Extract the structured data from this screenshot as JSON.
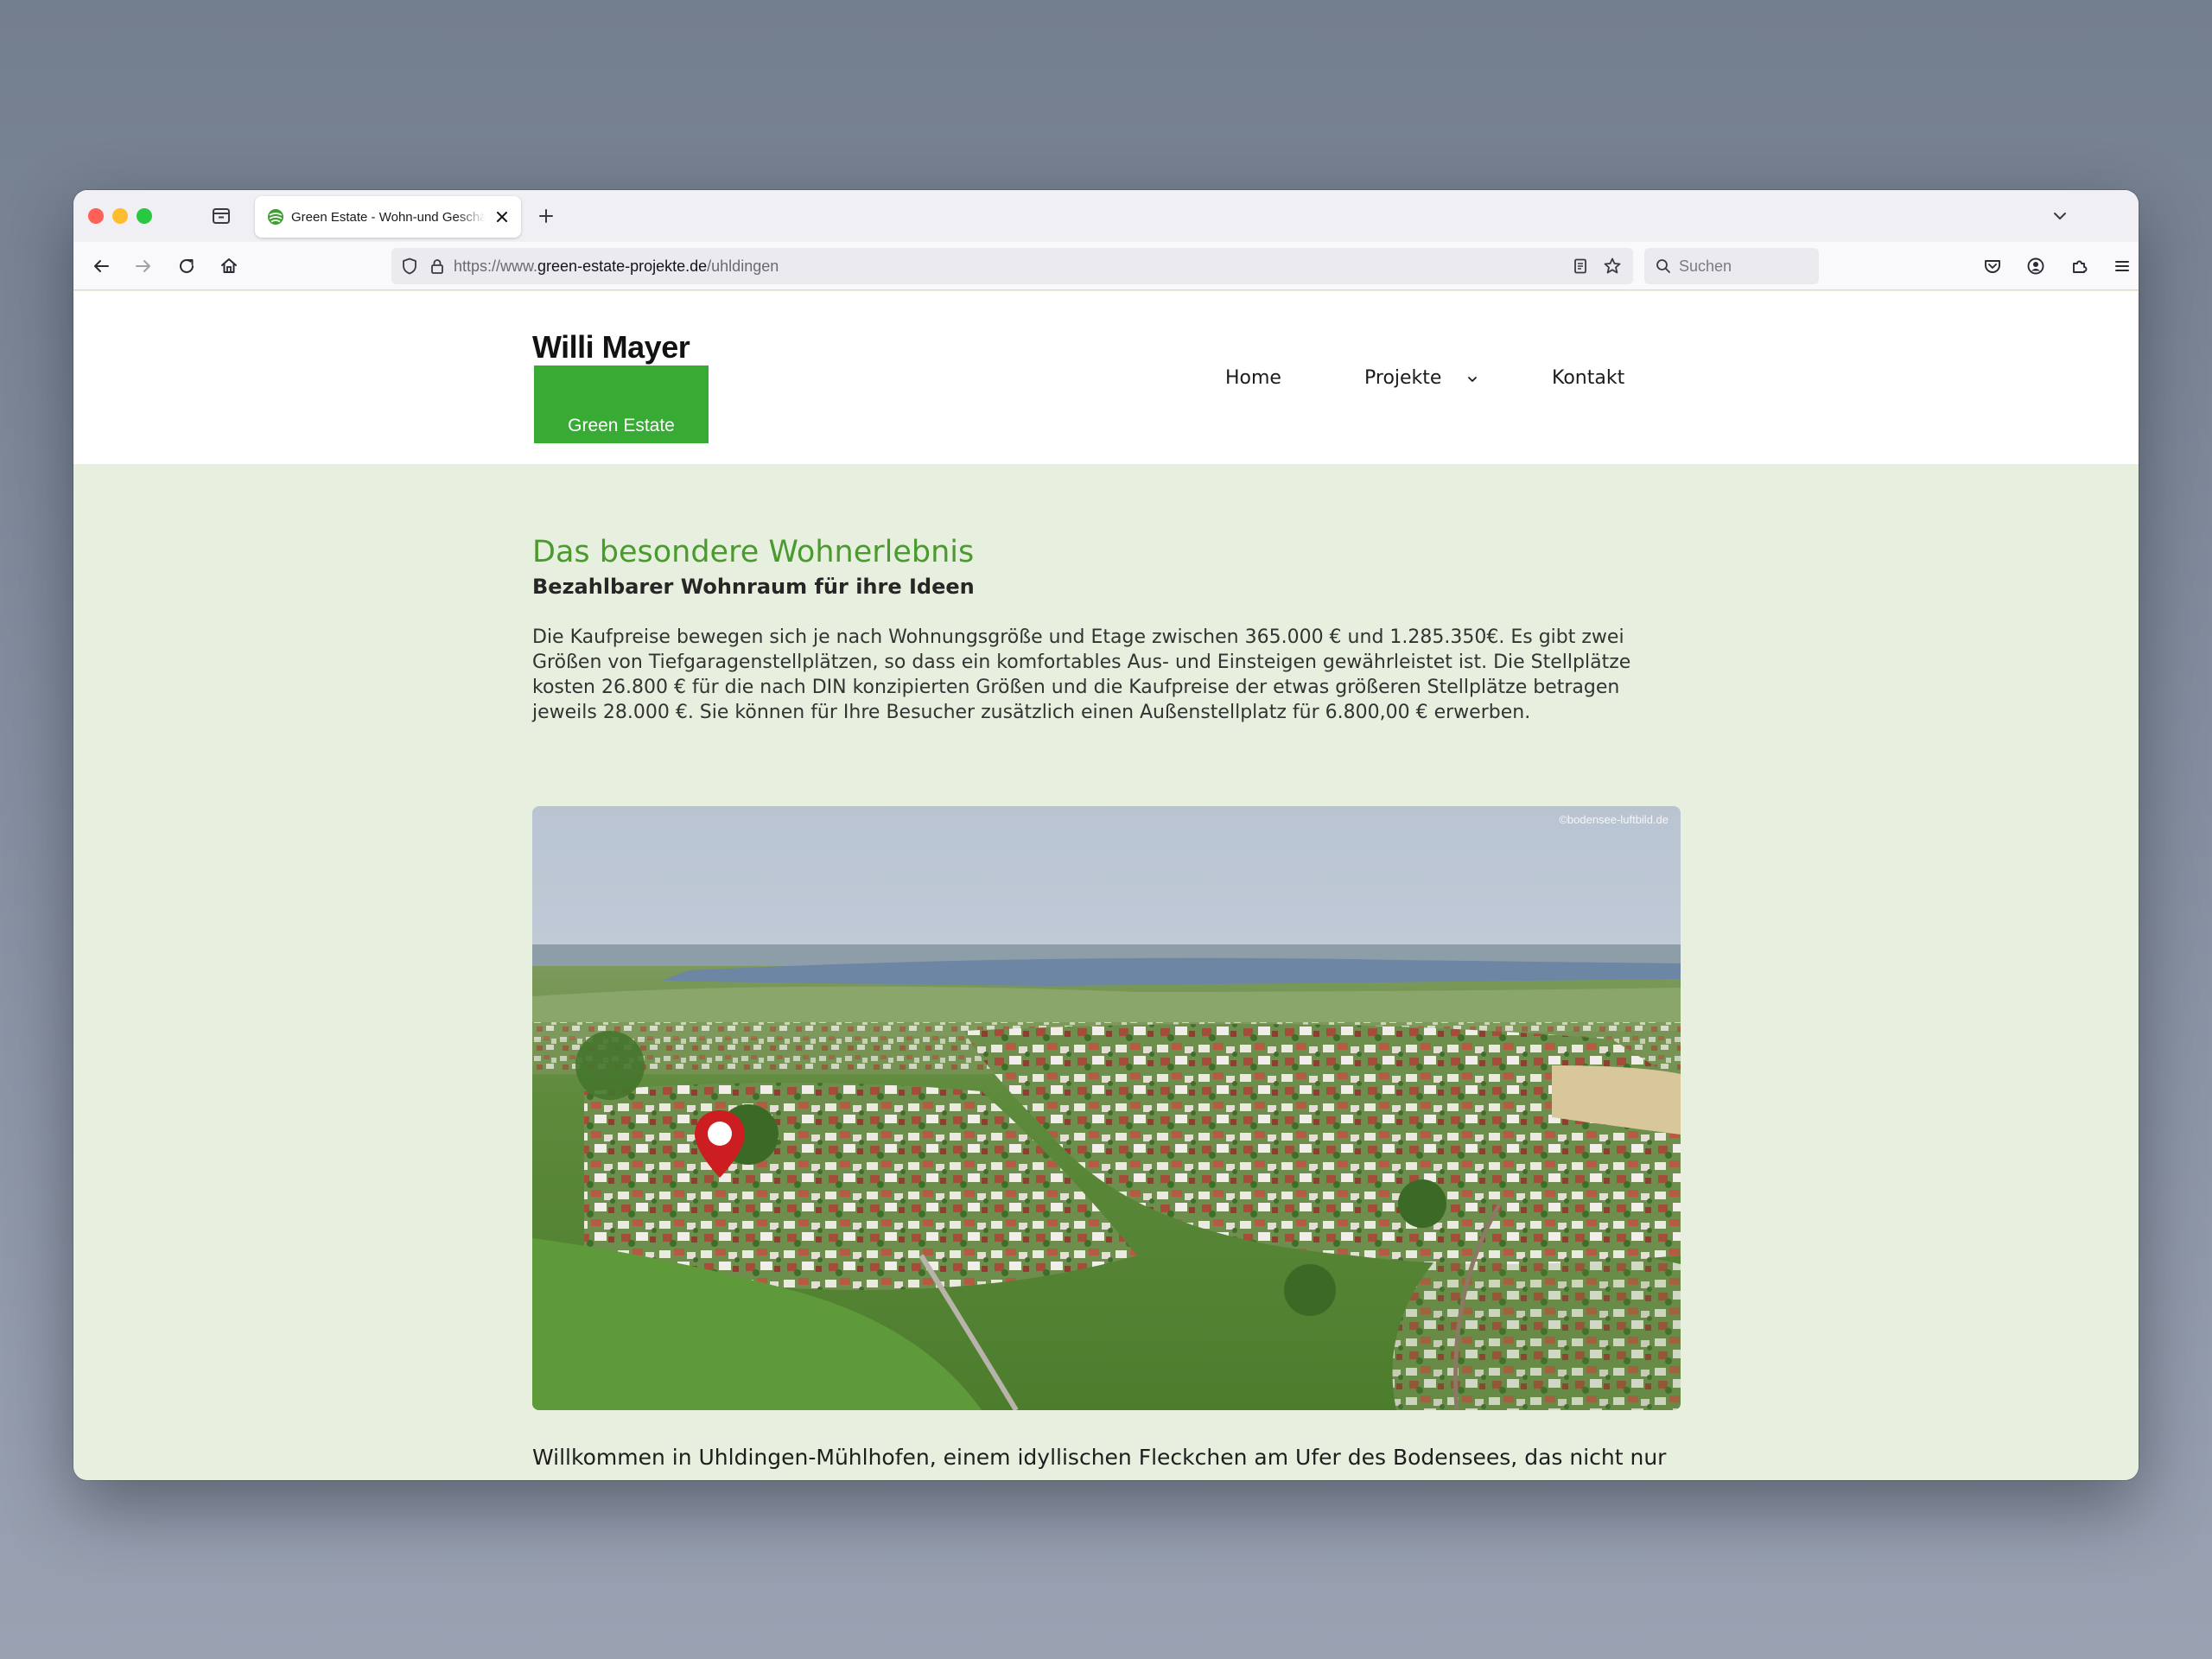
{
  "browser": {
    "tab": {
      "title": "Green Estate - Wohn-und Geschäftshaus"
    },
    "url": {
      "prefix": "https://www.",
      "domain": "green-estate-projekte.de",
      "path": "/uhldingen"
    },
    "search": {
      "placeholder": "Suchen"
    }
  },
  "site": {
    "logo": {
      "name": "Willi Mayer",
      "tagline": "Green Estate",
      "brand_color": "#38ab35"
    },
    "nav": [
      {
        "label": "Home"
      },
      {
        "label": "Projekte",
        "has_dropdown": true
      },
      {
        "label": "Kontakt"
      }
    ]
  },
  "main": {
    "heading": "Das besondere Wohnerlebnis",
    "subheading": "Bezahlbarer Wohnraum für ihre Ideen",
    "paragraph": "Die Kaufpreise bewegen sich je nach Wohnungsgröße und Etage zwischen 365.000 € und 1.285.350€. Es gibt zwei Größen von Tiefgaragenstellplätzen, so dass ein komfortables Aus- und Einsteigen gewährleistet ist. Die Stellplätze kosten 26.800 € für die nach DIN konzipierten Größen und die Kaufpreise der etwas größeren Stellplätze betragen jeweils 28.000 €. Sie können für Ihre Besucher zusätzlich einen Außenstellplatz für 6.800,00 € erwerben.",
    "image_credit": "©bodensee-luftbild.de",
    "intro": "Willkommen in Uhldingen-Mühlhofen, einem idyllischen Fleckchen am Ufer des Bodensees, das nicht nur",
    "heading_color": "#4b9a2e",
    "pin_color": "#cc1d20"
  }
}
